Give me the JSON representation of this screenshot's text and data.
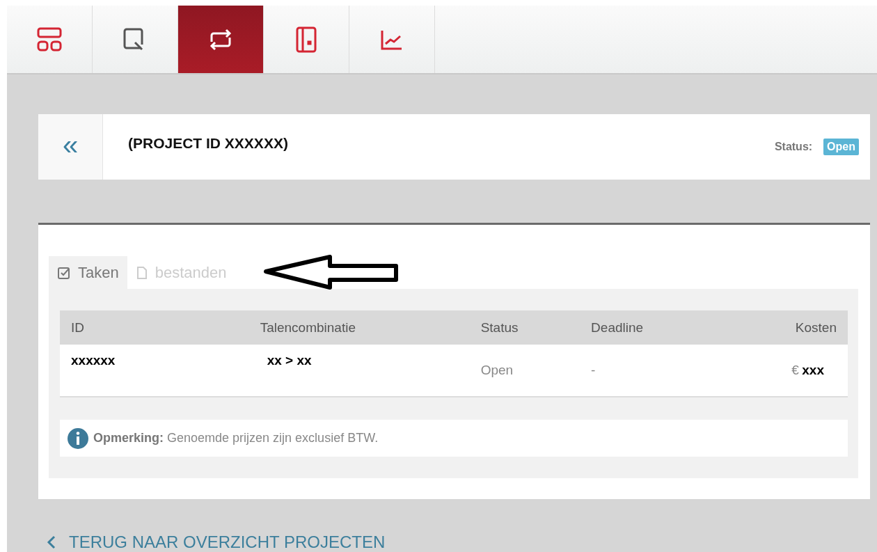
{
  "nav": [
    {
      "kind": "dashboard",
      "selected": false
    },
    {
      "kind": "search",
      "selected": false
    },
    {
      "kind": "repeat",
      "selected": true
    },
    {
      "kind": "book",
      "selected": false
    },
    {
      "kind": "chart",
      "selected": false
    }
  ],
  "header": {
    "back": "«",
    "title": "(PROJECT ID XXXXXX)",
    "status_label": "Status:",
    "status": "Open"
  },
  "tabs": [
    {
      "label": "Taken",
      "kind": "tasks",
      "selected": true
    },
    {
      "label": "bestanden",
      "kind": "files",
      "selected": false
    }
  ],
  "table": {
    "columns": [
      "ID",
      "Talencombinatie",
      "Status",
      "Deadline",
      "Kosten"
    ],
    "rows": [
      {
        "id": "xxxxxx",
        "languages": "xx > xx",
        "status": "Open",
        "deadline": "-",
        "currency": "€",
        "cost": "xxx"
      }
    ]
  },
  "note": "**Opmerking:** Genoemde prijzen zijn exclusief BTW.",
  "back_link": "TERUG NAAR OVERZICHT PROJECTEN"
}
